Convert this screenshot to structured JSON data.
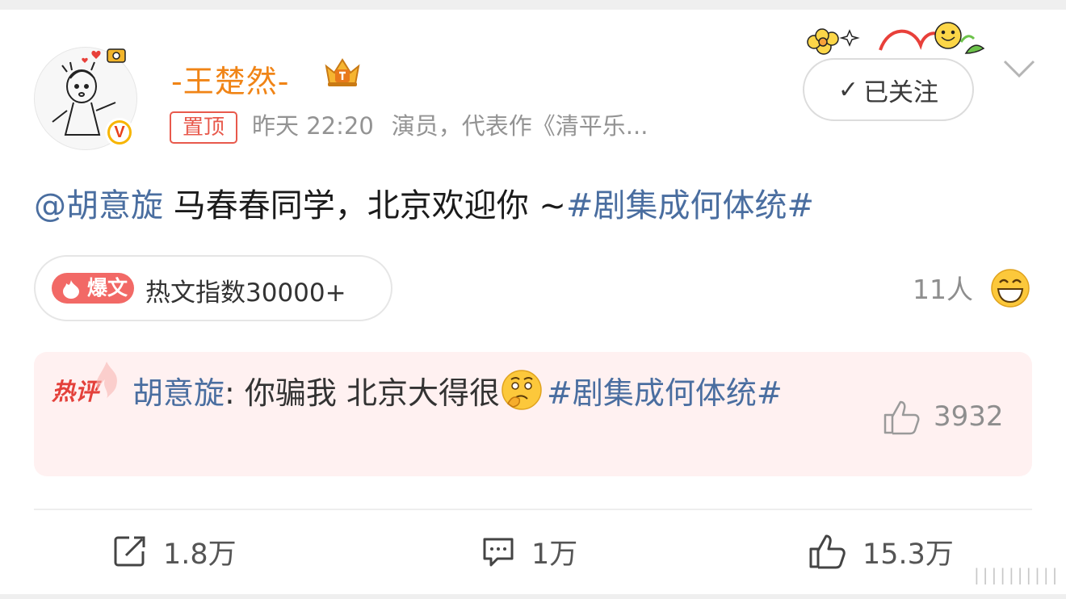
{
  "post": {
    "author": {
      "name": "-王楚然-",
      "avatar_icon": "cartoon-avatar-icon",
      "verified_icon": "verified-v-icon",
      "verified_letter": "V",
      "member_icon": "crown-icon"
    },
    "pinned_label": "置顶",
    "time": "昨天 22:20",
    "bio": "演员，代表作《清平乐...",
    "follow_button": {
      "check": "✓",
      "label": "已关注"
    },
    "content": {
      "mention": "@胡意旋",
      "text": " 马春春同学，北京欢迎你 ~",
      "topic": "#剧集成何体统#"
    },
    "hot_index": {
      "tag": "爆文",
      "text": "热文指数30000+"
    },
    "reactors_text": "11人",
    "hot_comment": {
      "label": "热评",
      "author": "胡意旋",
      "separator": ": ",
      "text": "你骗我 北京大得很",
      "emoji_icon": "thinking-emoji-icon",
      "topic": "#剧集成何体统#",
      "like_count": "3932"
    },
    "actions": {
      "repost": "1.8万",
      "comment": "1万",
      "like": "15.3万"
    },
    "watermark": "||||||||||"
  },
  "colors": {
    "name": "#f08416",
    "link": "#4a6ea0",
    "pin": "#e8594c",
    "hot_tag": "#f26966",
    "hot_comment_bg": "#fff1f1"
  }
}
